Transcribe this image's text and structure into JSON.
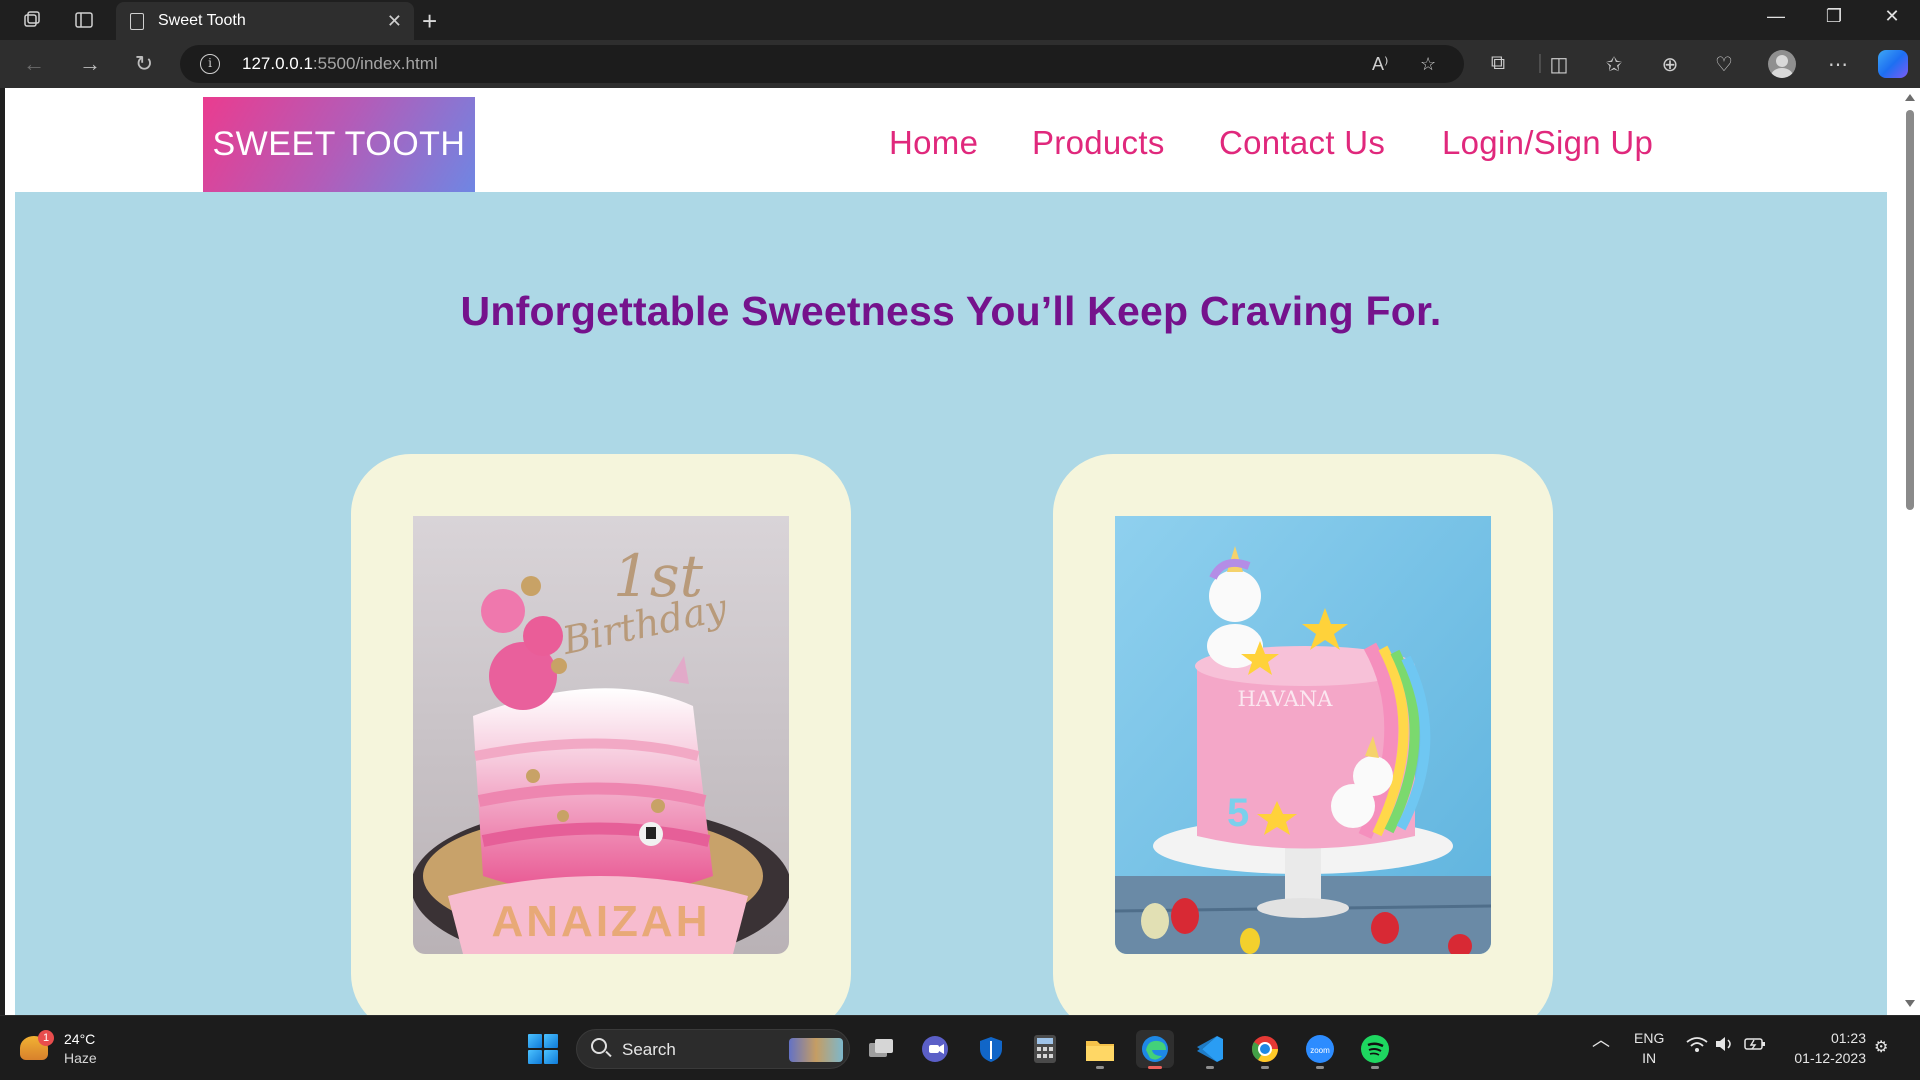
{
  "browser": {
    "tab_title": "Sweet Tooth",
    "url_host": "127.0.0.1",
    "url_path": ":5500/index.html"
  },
  "site": {
    "logo": "SWEET TOOTH",
    "nav": [
      "Home",
      "Products",
      "Contact Us",
      "Login/Sign Up"
    ],
    "headline": "Unforgettable Sweetness You’ll Keep Craving For.",
    "cards": [
      {
        "image_alt": "first-birthday-cake-photo",
        "topper": "1st Birthday",
        "banner": "ANAIZAH"
      },
      {
        "image_alt": "unicorn-rainbow-cake-photo",
        "name": "HAVANA",
        "number": "5"
      }
    ],
    "colors": {
      "logo_gradient": [
        "#ea3c8f",
        "#6f86e3"
      ],
      "nav_link": "#e0287c",
      "hero_bg": "#add8e6",
      "headline": "#75128c",
      "card_bg": "#f5f5dc"
    }
  },
  "taskbar": {
    "weather_temp": "24°C",
    "weather_cond": "Haze",
    "weather_badge": "1",
    "search_label": "Search",
    "language": "ENG",
    "region": "IN",
    "time": "01:23",
    "date": "01-12-2023"
  }
}
